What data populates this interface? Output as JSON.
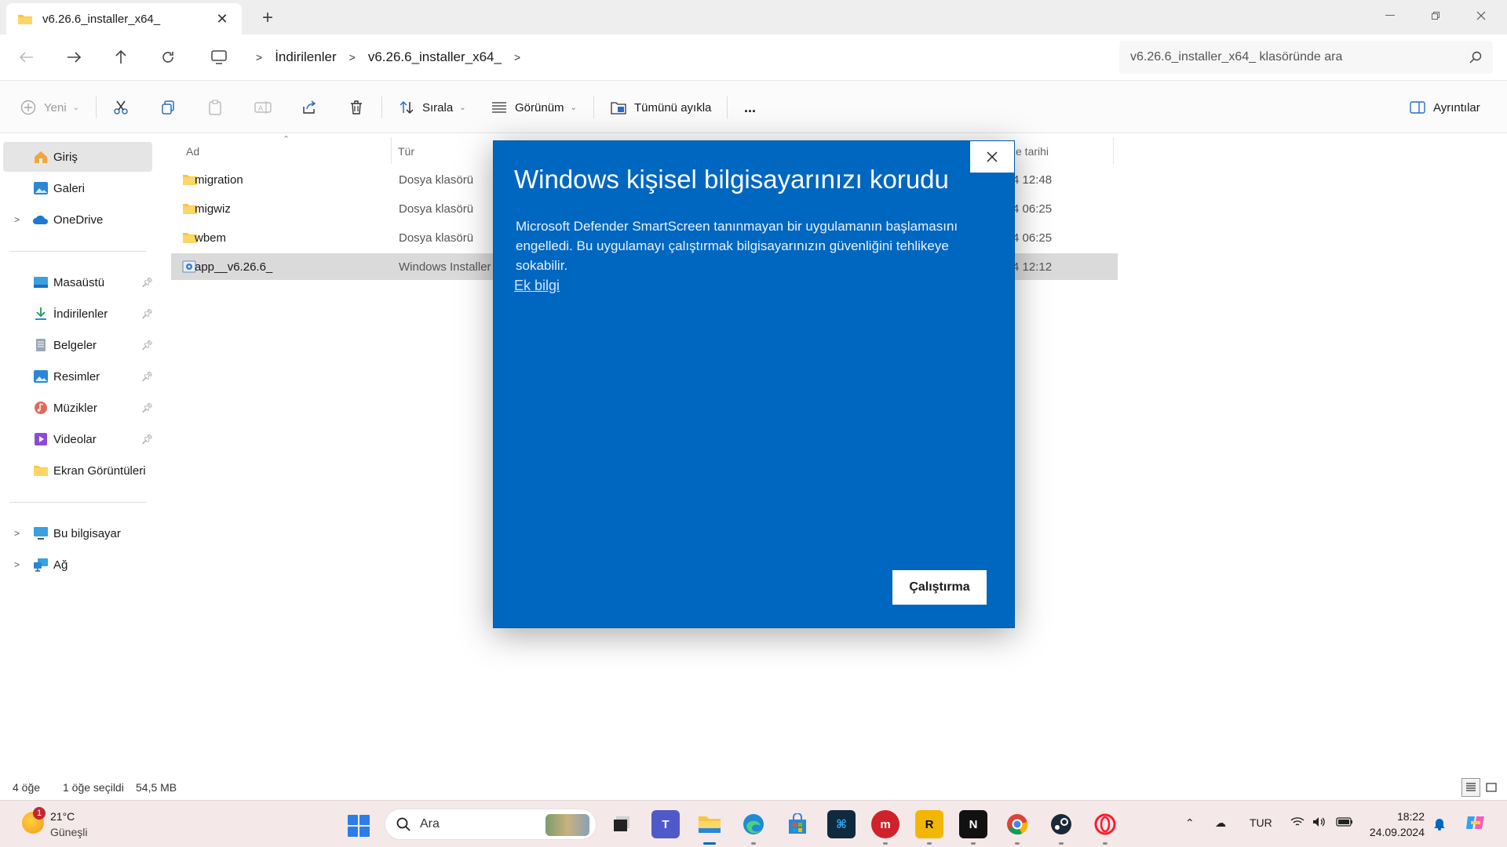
{
  "window": {
    "tab_title": "v6.26.6_installer_x64_",
    "new_tab_symbol": "+",
    "controls": [
      "minimize",
      "restore",
      "close"
    ]
  },
  "navigation": {
    "breadcrumbs": [
      "İndirilenler",
      "v6.26.6_installer_x64_"
    ],
    "search_placeholder": "v6.26.6_installer_x64_ klasöründe ara"
  },
  "command_bar": {
    "new_label": "Yeni",
    "sort_label": "Sırala",
    "view_label": "Görünüm",
    "extract_all_label": "Tümünü ayıkla",
    "more_label": "...",
    "details_label": "Ayrıntılar"
  },
  "sidebar": {
    "items": [
      {
        "label": "Giriş",
        "icon": "home-icon",
        "selected": true
      },
      {
        "label": "Galeri",
        "icon": "gallery-icon"
      },
      {
        "label": "OneDrive",
        "icon": "onedrive-icon",
        "expandable": true
      },
      {
        "label": "Masaüstü",
        "icon": "desktop-icon",
        "pinned": true
      },
      {
        "label": "İndirilenler",
        "icon": "downloads-icon",
        "pinned": true
      },
      {
        "label": "Belgeler",
        "icon": "documents-icon",
        "pinned": true
      },
      {
        "label": "Resimler",
        "icon": "pictures-icon",
        "pinned": true
      },
      {
        "label": "Müzikler",
        "icon": "music-icon",
        "pinned": true
      },
      {
        "label": "Videolar",
        "icon": "videos-icon",
        "pinned": true
      },
      {
        "label": "Ekran Görüntüleri",
        "icon": "folder-icon"
      },
      {
        "label": "Bu bilgisayar",
        "icon": "this-pc-icon",
        "expandable": true
      },
      {
        "label": "Ağ",
        "icon": "network-icon",
        "expandable": true
      }
    ]
  },
  "file_list": {
    "columns": {
      "name": "Ad",
      "type": "Tür",
      "date": "e tarihi"
    },
    "rows": [
      {
        "name": "migration",
        "type": "Dosya klasörü",
        "date": "4 12:48",
        "icon": "folder-icon"
      },
      {
        "name": "migwiz",
        "type": "Dosya klasörü",
        "date": "4 06:25",
        "icon": "folder-icon"
      },
      {
        "name": "wbem",
        "type": "Dosya klasörü",
        "date": "4 06:25",
        "icon": "folder-icon"
      },
      {
        "name": "app__v6.26.6_",
        "type": "Windows Installer",
        "date": "4 12:12",
        "icon": "installer-icon",
        "selected": true
      }
    ]
  },
  "status_bar": {
    "item_count": "4 öğe",
    "selection": "1 öğe seçildi",
    "size": "54,5 MB"
  },
  "dialog": {
    "title": "Windows kişisel bilgisayarınızı korudu",
    "body": "Microsoft Defender SmartScreen tanınmayan bir uygulamanın başlamasını engelledi. Bu uygulamayı çalıştırmak bilgisayarınızın güvenliğini tehlikeye sokabilir.",
    "link": "Ek bilgi",
    "button": "Çalıştırma",
    "background": "#0067c0"
  },
  "taskbar": {
    "weather_temp": "21°C",
    "weather_condition": "Güneşli",
    "weather_badge": "1",
    "search_label": "Ara",
    "language": "TUR",
    "time": "18:22",
    "date": "24.09.2024"
  }
}
